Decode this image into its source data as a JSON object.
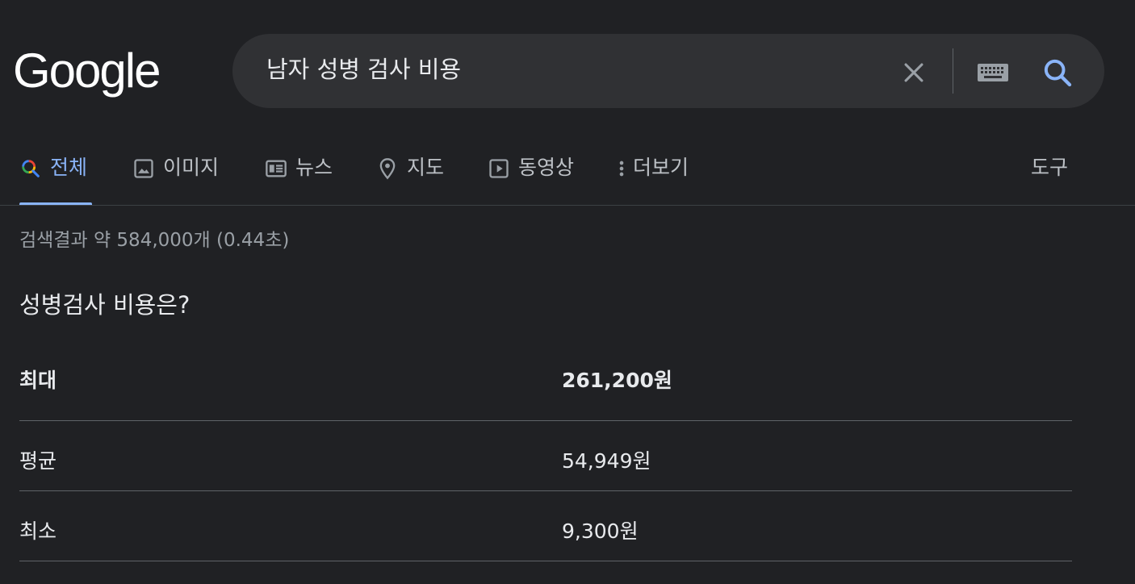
{
  "logo": {
    "text": "Google"
  },
  "search": {
    "query": "남자 성병 검사 비용"
  },
  "tabs": [
    {
      "label": "전체",
      "icon": "search-icon",
      "active": true
    },
    {
      "label": "이미지",
      "icon": "image-icon"
    },
    {
      "label": "뉴스",
      "icon": "news-icon"
    },
    {
      "label": "지도",
      "icon": "map-pin-icon"
    },
    {
      "label": "동영상",
      "icon": "video-icon"
    },
    {
      "label": "더보기",
      "icon": "more-vert-icon"
    }
  ],
  "tools_label": "도구",
  "result_stats": "검색결과 약 584,000개 (0.44초)",
  "featured": {
    "question": "성병검사 비용은?",
    "rows": [
      {
        "label": "최대",
        "value": "261,200원"
      },
      {
        "label": "평균",
        "value": "54,949원"
      },
      {
        "label": "최소",
        "value": "9,300원"
      }
    ]
  },
  "colors": {
    "background": "#202124",
    "accent": "#8ab4f8",
    "searchbox": "#303134"
  }
}
